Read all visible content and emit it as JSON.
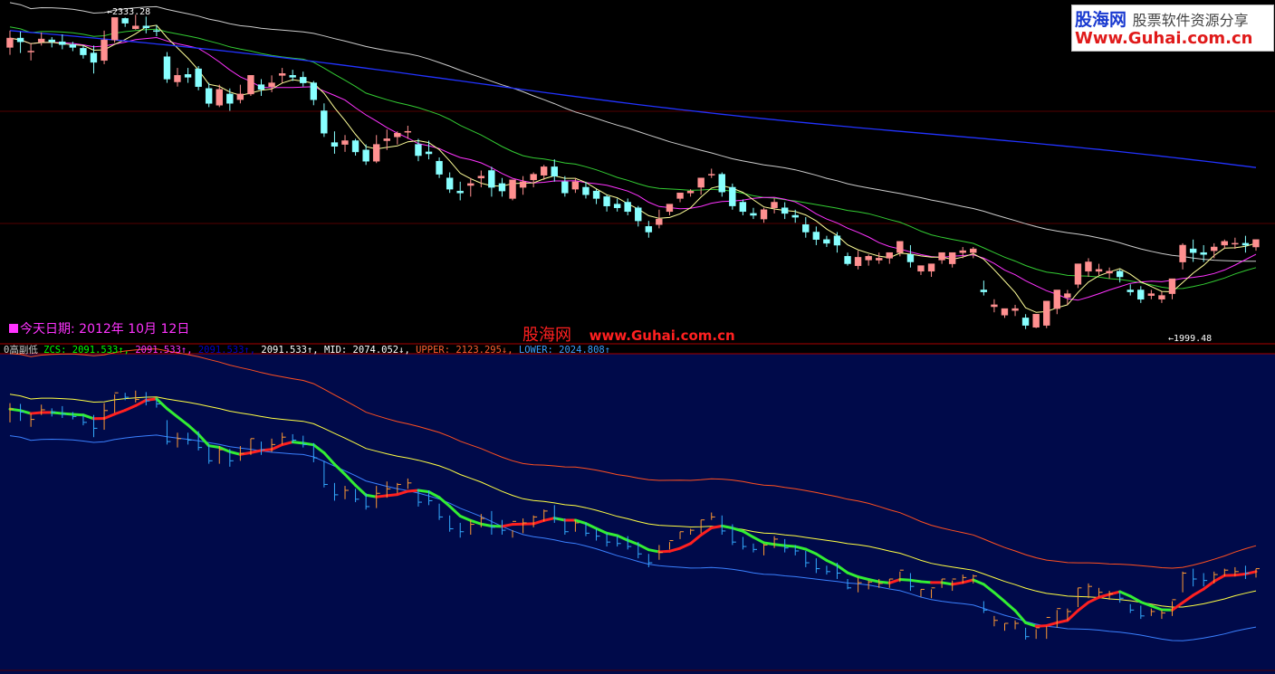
{
  "logo": {
    "brand": "股海网",
    "slogan": "股票软件资源分享",
    "url": "Www.Guhai.com.cn"
  },
  "today_label": "今天日期: 2012年 10月 12日",
  "watermark": {
    "cn": "股海网",
    "url": "www.Guhai.com.cn"
  },
  "price_labels": {
    "high": "2333.28",
    "low": "1999.48"
  },
  "indicator": {
    "name": "0高副低",
    "items": [
      {
        "text": "ZCS: 2091.533↑,",
        "color": "#00ff00"
      },
      {
        "text": "2091.533↑,",
        "color": "#ff33ff"
      },
      {
        "text": "2091.533↑,",
        "color": "#0000cc"
      },
      {
        "text": "2091.533↑,",
        "color": "#ffffff"
      },
      {
        "text": "MID: 2074.052↓,",
        "color": "#ffffff"
      },
      {
        "text": "UPPER: 2123.295↓,",
        "color": "#ff6030"
      },
      {
        "text": "LOWER: 2024.808↑",
        "color": "#3aa0ff"
      }
    ]
  },
  "colors": {
    "up": "#ff9090",
    "down": "#88ffff",
    "ma5": "#ffff99",
    "ma10": "#ff33ff",
    "ma20": "#33cc33",
    "ma60": "#cccccc",
    "ma120": "#2233ff",
    "lower_bg": "#000a4a",
    "upper_band": "#ff5020",
    "mid_band": "#ffff44",
    "lower_band": "#3a80ff",
    "zcs_green": "#33ee33",
    "zcs_red": "#ff2020"
  },
  "chart_data": [
    {
      "type": "candlestick",
      "title": "",
      "ylim": [
        1990,
        2345
      ],
      "annotations": [
        "2333.28",
        "1999.48"
      ],
      "ohlc": [
        [
          2300,
          2318,
          2310,
          2292
        ],
        [
          2310,
          2317,
          2306,
          2294
        ],
        [
          2296,
          2304,
          2296,
          2286
        ],
        [
          2306,
          2316,
          2309,
          2302
        ],
        [
          2308,
          2311,
          2306,
          2300
        ],
        [
          2306,
          2314,
          2303,
          2298
        ],
        [
          2303,
          2306,
          2300,
          2296
        ],
        [
          2299,
          2302,
          2292,
          2288
        ],
        [
          2294,
          2302,
          2284,
          2272
        ],
        [
          2286,
          2318,
          2308,
          2282
        ],
        [
          2308,
          2330,
          2332,
          2305
        ],
        [
          2331,
          2332,
          2326,
          2322
        ],
        [
          2320,
          2335,
          2323,
          2319
        ],
        [
          2323,
          2333,
          2321,
          2315
        ],
        [
          2318,
          2324,
          2317,
          2312
        ],
        [
          2290,
          2295,
          2266,
          2262
        ],
        [
          2263,
          2278,
          2270,
          2258
        ],
        [
          2271,
          2278,
          2268,
          2262
        ],
        [
          2277,
          2280,
          2258,
          2254
        ],
        [
          2256,
          2262,
          2240,
          2236
        ],
        [
          2238,
          2260,
          2255,
          2236
        ],
        [
          2250,
          2256,
          2240,
          2232
        ],
        [
          2244,
          2260,
          2250,
          2240
        ],
        [
          2250,
          2270,
          2270,
          2248
        ],
        [
          2260,
          2266,
          2255,
          2248
        ],
        [
          2258,
          2270,
          2262,
          2252
        ],
        [
          2270,
          2278,
          2272,
          2262
        ],
        [
          2270,
          2276,
          2268,
          2264
        ],
        [
          2268,
          2274,
          2262,
          2258
        ],
        [
          2262,
          2264,
          2244,
          2238
        ],
        [
          2232,
          2240,
          2208,
          2204
        ],
        [
          2198,
          2210,
          2194,
          2186
        ],
        [
          2196,
          2206,
          2200,
          2188
        ],
        [
          2200,
          2202,
          2188,
          2184
        ],
        [
          2190,
          2196,
          2178,
          2174
        ],
        [
          2178,
          2206,
          2196,
          2176
        ],
        [
          2200,
          2212,
          2202,
          2190
        ],
        [
          2204,
          2210,
          2208,
          2196
        ],
        [
          2210,
          2216,
          2210,
          2202
        ],
        [
          2196,
          2202,
          2184,
          2178
        ],
        [
          2188,
          2200,
          2186,
          2180
        ],
        [
          2178,
          2182,
          2164,
          2160
        ],
        [
          2160,
          2166,
          2148,
          2144
        ],
        [
          2146,
          2156,
          2144,
          2136
        ],
        [
          2152,
          2160,
          2154,
          2140
        ],
        [
          2160,
          2168,
          2162,
          2150
        ],
        [
          2168,
          2172,
          2150,
          2140
        ],
        [
          2154,
          2160,
          2146,
          2140
        ],
        [
          2138,
          2146,
          2158,
          2136
        ],
        [
          2150,
          2162,
          2156,
          2142
        ],
        [
          2158,
          2166,
          2164,
          2150
        ],
        [
          2163,
          2174,
          2172,
          2158
        ],
        [
          2172,
          2180,
          2162,
          2156
        ],
        [
          2156,
          2162,
          2144,
          2140
        ],
        [
          2148,
          2160,
          2156,
          2144
        ],
        [
          2150,
          2156,
          2142,
          2138
        ],
        [
          2146,
          2148,
          2138,
          2132
        ],
        [
          2140,
          2142,
          2130,
          2124
        ],
        [
          2132,
          2138,
          2128,
          2124
        ],
        [
          2134,
          2138,
          2124,
          2120
        ],
        [
          2128,
          2130,
          2114,
          2108
        ],
        [
          2108,
          2114,
          2102,
          2096
        ],
        [
          2110,
          2126,
          2116,
          2106
        ],
        [
          2124,
          2130,
          2132,
          2120
        ],
        [
          2138,
          2144,
          2144,
          2134
        ],
        [
          2144,
          2148,
          2146,
          2140
        ],
        [
          2150,
          2160,
          2160,
          2142
        ],
        [
          2164,
          2170,
          2164,
          2160
        ],
        [
          2164,
          2166,
          2145,
          2140
        ],
        [
          2150,
          2154,
          2130,
          2126
        ],
        [
          2134,
          2137,
          2124,
          2120
        ],
        [
          2122,
          2128,
          2120,
          2116
        ],
        [
          2116,
          2128,
          2126,
          2112
        ],
        [
          2128,
          2138,
          2134,
          2122
        ],
        [
          2128,
          2134,
          2122,
          2116
        ],
        [
          2120,
          2126,
          2118,
          2112
        ],
        [
          2110,
          2118,
          2102,
          2096
        ],
        [
          2102,
          2108,
          2094,
          2088
        ],
        [
          2094,
          2098,
          2090,
          2086
        ],
        [
          2098,
          2102,
          2088,
          2080
        ],
        [
          2076,
          2080,
          2068,
          2066
        ],
        [
          2066,
          2082,
          2075,
          2062
        ],
        [
          2072,
          2078,
          2076,
          2066
        ],
        [
          2072,
          2080,
          2074,
          2068
        ],
        [
          2074,
          2080,
          2080,
          2068
        ],
        [
          2080,
          2090,
          2092,
          2076
        ],
        [
          2078,
          2088,
          2070,
          2064
        ],
        [
          2060,
          2066,
          2066,
          2056
        ],
        [
          2060,
          2066,
          2068,
          2054
        ],
        [
          2072,
          2080,
          2080,
          2068
        ],
        [
          2068,
          2078,
          2080,
          2064
        ],
        [
          2080,
          2086,
          2082,
          2074
        ],
        [
          2080,
          2086,
          2084,
          2074
        ],
        [
          2040,
          2050,
          2038,
          2034
        ],
        [
          2022,
          2030,
          2024,
          2016
        ],
        [
          2013,
          2020,
          2020,
          2010
        ],
        [
          2018,
          2024,
          2020,
          2012
        ],
        [
          2010,
          2014,
          2002,
          1998
        ],
        [
          2000,
          2012,
          2014,
          1999
        ],
        [
          2002,
          2016,
          2028,
          1999
        ],
        [
          2020,
          2038,
          2040,
          2014
        ],
        [
          2032,
          2040,
          2036,
          2024
        ],
        [
          2046,
          2068,
          2068,
          2042
        ],
        [
          2060,
          2074,
          2070,
          2054
        ],
        [
          2060,
          2068,
          2062,
          2056
        ],
        [
          2058,
          2064,
          2060,
          2052
        ],
        [
          2060,
          2062,
          2054,
          2048
        ],
        [
          2040,
          2046,
          2038,
          2034
        ],
        [
          2040,
          2044,
          2030,
          2026
        ],
        [
          2034,
          2040,
          2036,
          2030
        ],
        [
          2030,
          2038,
          2034,
          2026
        ],
        [
          2036,
          2050,
          2052,
          2030
        ],
        [
          2070,
          2090,
          2088,
          2062
        ],
        [
          2084,
          2094,
          2080,
          2070
        ],
        [
          2080,
          2088,
          2078,
          2070
        ],
        [
          2082,
          2090,
          2086,
          2074
        ],
        [
          2088,
          2094,
          2092,
          2084
        ],
        [
          2090,
          2096,
          2090,
          2084
        ],
        [
          2090,
          2098,
          2088,
          2080
        ],
        [
          2086,
          2094,
          2094,
          2082
        ]
      ]
    },
    {
      "type": "line",
      "title": "",
      "series": [
        {
          "name": "ZCS",
          "values": [
            2091.533
          ]
        },
        {
          "name": "MID",
          "values": [
            2074.052
          ]
        },
        {
          "name": "UPPER",
          "values": [
            2123.295
          ]
        },
        {
          "name": "LOWER",
          "values": [
            2024.808
          ]
        }
      ]
    }
  ]
}
